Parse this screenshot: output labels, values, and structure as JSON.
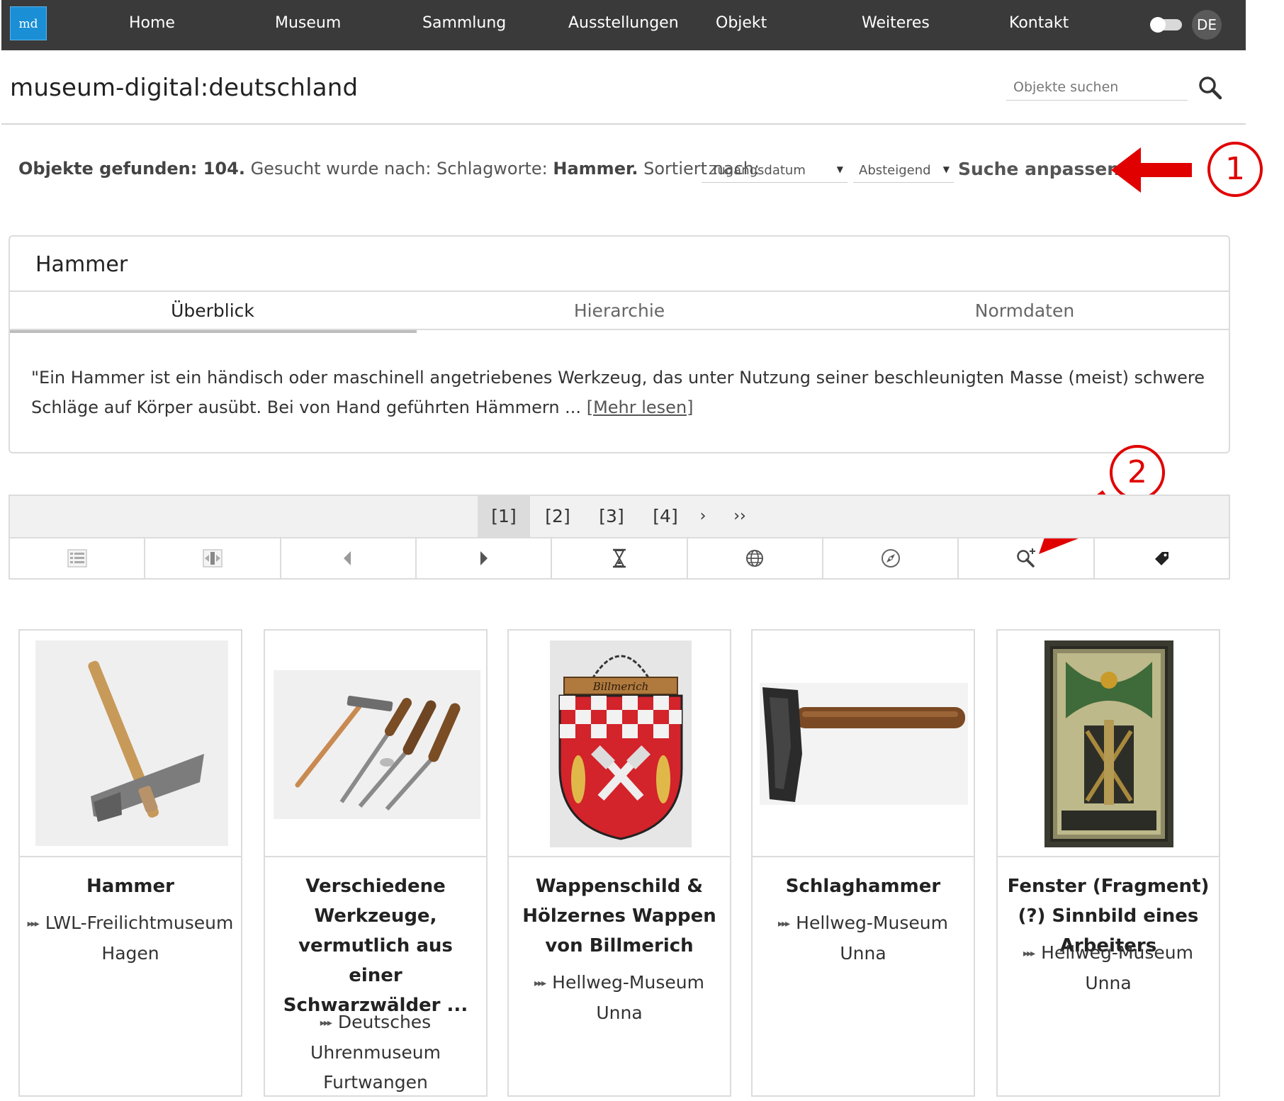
{
  "nav": {
    "logo": "md",
    "items": [
      "Home",
      "Museum",
      "Sammlung",
      "Ausstellungen",
      "Objekt",
      "Weiteres",
      "Kontakt"
    ],
    "language": "DE"
  },
  "header": {
    "site_title": "museum-digital:deutschland",
    "search_placeholder": "Objekte suchen"
  },
  "results": {
    "found_label": "Objekte gefunden: 104.",
    "searched_label": "Gesucht wurde nach: Schlagworte:",
    "keyword": "Hammer.",
    "sorted_label": "Sortiert nach:",
    "sort_field": "Zugangsdatum",
    "sort_order": "Absteigend",
    "adjust_label": "Suche anpassen."
  },
  "annotations": {
    "one": "1",
    "two": "2",
    "color": "#e00000"
  },
  "panel": {
    "title": "Hammer",
    "tabs": [
      "Überblick",
      "Hierarchie",
      "Normdaten"
    ],
    "description": "\"Ein Hammer ist ein händisch oder maschinell angetriebenes Werkzeug, das unter Nutzung seiner beschleunigten Masse (meist) schwere Schläge auf Körper ausübt. Bei von Hand geführten Hämmern ...",
    "more_link": "[Mehr lesen]"
  },
  "pager": {
    "pages": [
      "[1]",
      "[2]",
      "[3]",
      "[4]"
    ],
    "next": "›",
    "last": "››"
  },
  "toolbar": {
    "icons": [
      "list-view-icon",
      "compare-view-icon",
      "previous-icon",
      "next-icon",
      "timeline-hourglass-icon",
      "globe-icon",
      "compass-icon",
      "search-plus-icon",
      "tag-icon"
    ]
  },
  "cards": [
    {
      "title": "Hammer",
      "museum": "LWL-Freilichtmuseum Hagen"
    },
    {
      "title": "Verschiedene Werkzeuge, vermutlich aus einer Schwarzwälder ...",
      "museum": "Deutsches Uhrenmuseum Furtwangen"
    },
    {
      "title": "Wappenschild & Hölzernes Wappen von Billmerich",
      "museum": "Hellweg-Museum Unna"
    },
    {
      "title": "Schlaghammer",
      "museum": "Hellweg-Museum Unna"
    },
    {
      "title": "Fenster (Fragment) (?) Sinnbild eines Arbeiters",
      "museum": "Hellweg-Museum Unna"
    }
  ],
  "coat_of_arms_text": "Billmerich"
}
